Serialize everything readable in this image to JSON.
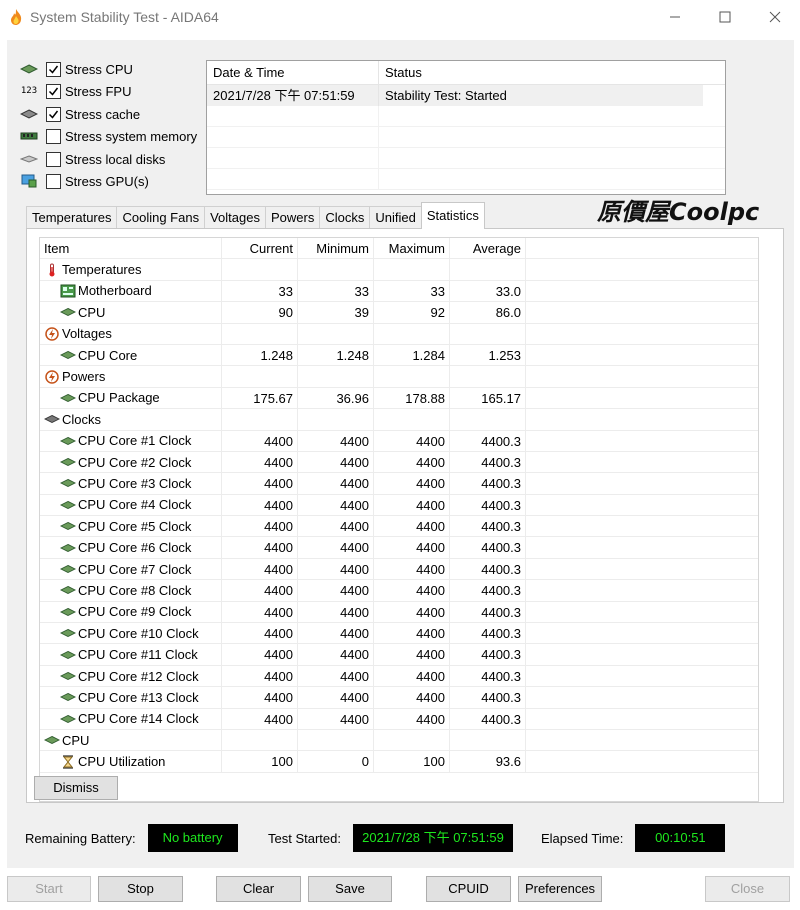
{
  "window": {
    "title": "System Stability Test - AIDA64",
    "minimize_icon": "minimize-icon",
    "maximize_icon": "maximize-icon",
    "close_icon": "close-icon"
  },
  "stress_options": [
    {
      "label": "Stress CPU",
      "checked": true,
      "icon": "cpu-chip-icon"
    },
    {
      "label": "Stress FPU",
      "checked": true,
      "icon": "fpu-123-icon"
    },
    {
      "label": "Stress cache",
      "checked": true,
      "icon": "cache-chip-icon"
    },
    {
      "label": "Stress system memory",
      "checked": false,
      "icon": "memory-module-icon"
    },
    {
      "label": "Stress local disks",
      "checked": false,
      "icon": "disk-drive-icon"
    },
    {
      "label": "Stress GPU(s)",
      "checked": false,
      "icon": "gpu-monitor-icon"
    }
  ],
  "log": {
    "headers": [
      "Date & Time",
      "Status"
    ],
    "rows": [
      {
        "datetime": "2021/7/28 下午 07:51:59",
        "status": "Stability Test: Started"
      }
    ]
  },
  "tabs": [
    "Temperatures",
    "Cooling Fans",
    "Voltages",
    "Powers",
    "Clocks",
    "Unified",
    "Statistics"
  ],
  "active_tab": "Statistics",
  "watermark": {
    "cjk": "原價屋",
    "latin": "Coolpc"
  },
  "stats": {
    "headers": [
      "Item",
      "Current",
      "Minimum",
      "Maximum",
      "Average"
    ],
    "rows": [
      {
        "type": "group",
        "icon": "thermometer-icon",
        "item": "Temperatures"
      },
      {
        "type": "item",
        "icon": "motherboard-icon",
        "item": "Motherboard",
        "current": "33",
        "minimum": "33",
        "maximum": "33",
        "average": "33.0"
      },
      {
        "type": "item",
        "icon": "cpu-chip-icon",
        "item": "CPU",
        "current": "90",
        "minimum": "39",
        "maximum": "92",
        "average": "86.0"
      },
      {
        "type": "group",
        "icon": "voltage-icon",
        "item": "Voltages"
      },
      {
        "type": "item",
        "icon": "cpu-chip-icon",
        "item": "CPU Core",
        "current": "1.248",
        "minimum": "1.248",
        "maximum": "1.284",
        "average": "1.253"
      },
      {
        "type": "group",
        "icon": "power-icon",
        "item": "Powers"
      },
      {
        "type": "item",
        "icon": "cpu-chip-icon",
        "item": "CPU Package",
        "current": "175.67",
        "minimum": "36.96",
        "maximum": "178.88",
        "average": "165.17"
      },
      {
        "type": "group",
        "icon": "clock-chip-icon",
        "item": "Clocks"
      },
      {
        "type": "item",
        "icon": "cpu-chip-icon",
        "item": "CPU Core #1 Clock",
        "current": "4400",
        "minimum": "4400",
        "maximum": "4400",
        "average": "4400.3"
      },
      {
        "type": "item",
        "icon": "cpu-chip-icon",
        "item": "CPU Core #2 Clock",
        "current": "4400",
        "minimum": "4400",
        "maximum": "4400",
        "average": "4400.3"
      },
      {
        "type": "item",
        "icon": "cpu-chip-icon",
        "item": "CPU Core #3 Clock",
        "current": "4400",
        "minimum": "4400",
        "maximum": "4400",
        "average": "4400.3"
      },
      {
        "type": "item",
        "icon": "cpu-chip-icon",
        "item": "CPU Core #4 Clock",
        "current": "4400",
        "minimum": "4400",
        "maximum": "4400",
        "average": "4400.3"
      },
      {
        "type": "item",
        "icon": "cpu-chip-icon",
        "item": "CPU Core #5 Clock",
        "current": "4400",
        "minimum": "4400",
        "maximum": "4400",
        "average": "4400.3"
      },
      {
        "type": "item",
        "icon": "cpu-chip-icon",
        "item": "CPU Core #6 Clock",
        "current": "4400",
        "minimum": "4400",
        "maximum": "4400",
        "average": "4400.3"
      },
      {
        "type": "item",
        "icon": "cpu-chip-icon",
        "item": "CPU Core #7 Clock",
        "current": "4400",
        "minimum": "4400",
        "maximum": "4400",
        "average": "4400.3"
      },
      {
        "type": "item",
        "icon": "cpu-chip-icon",
        "item": "CPU Core #8 Clock",
        "current": "4400",
        "minimum": "4400",
        "maximum": "4400",
        "average": "4400.3"
      },
      {
        "type": "item",
        "icon": "cpu-chip-icon",
        "item": "CPU Core #9 Clock",
        "current": "4400",
        "minimum": "4400",
        "maximum": "4400",
        "average": "4400.3"
      },
      {
        "type": "item",
        "icon": "cpu-chip-icon",
        "item": "CPU Core #10 Clock",
        "current": "4400",
        "minimum": "4400",
        "maximum": "4400",
        "average": "4400.3"
      },
      {
        "type": "item",
        "icon": "cpu-chip-icon",
        "item": "CPU Core #11 Clock",
        "current": "4400",
        "minimum": "4400",
        "maximum": "4400",
        "average": "4400.3"
      },
      {
        "type": "item",
        "icon": "cpu-chip-icon",
        "item": "CPU Core #12 Clock",
        "current": "4400",
        "minimum": "4400",
        "maximum": "4400",
        "average": "4400.3"
      },
      {
        "type": "item",
        "icon": "cpu-chip-icon",
        "item": "CPU Core #13 Clock",
        "current": "4400",
        "minimum": "4400",
        "maximum": "4400",
        "average": "4400.3"
      },
      {
        "type": "item",
        "icon": "cpu-chip-icon",
        "item": "CPU Core #14 Clock",
        "current": "4400",
        "minimum": "4400",
        "maximum": "4400",
        "average": "4400.3"
      },
      {
        "type": "group",
        "icon": "cpu-chip-icon",
        "item": "CPU"
      },
      {
        "type": "item",
        "icon": "hourglass-icon",
        "item": "CPU Utilization",
        "current": "100",
        "minimum": "0",
        "maximum": "100",
        "average": "93.6"
      }
    ]
  },
  "dismiss_label": "Dismiss",
  "status_bar": {
    "battery_label": "Remaining Battery:",
    "battery_value": "No battery",
    "started_label": "Test Started:",
    "started_value": "2021/7/28 下午 07:51:59",
    "elapsed_label": "Elapsed Time:",
    "elapsed_value": "00:10:51",
    "led_text_color": "#1ee81e",
    "led_bg_color": "#000000"
  },
  "buttons": {
    "start": {
      "label": "Start",
      "enabled": false
    },
    "stop": {
      "label": "Stop",
      "enabled": true
    },
    "clear": {
      "label": "Clear",
      "enabled": true
    },
    "save": {
      "label": "Save",
      "enabled": true
    },
    "cpuid": {
      "label": "CPUID",
      "enabled": true
    },
    "preferences": {
      "label": "Preferences",
      "enabled": true
    },
    "close": {
      "label": "Close",
      "enabled": false
    }
  }
}
